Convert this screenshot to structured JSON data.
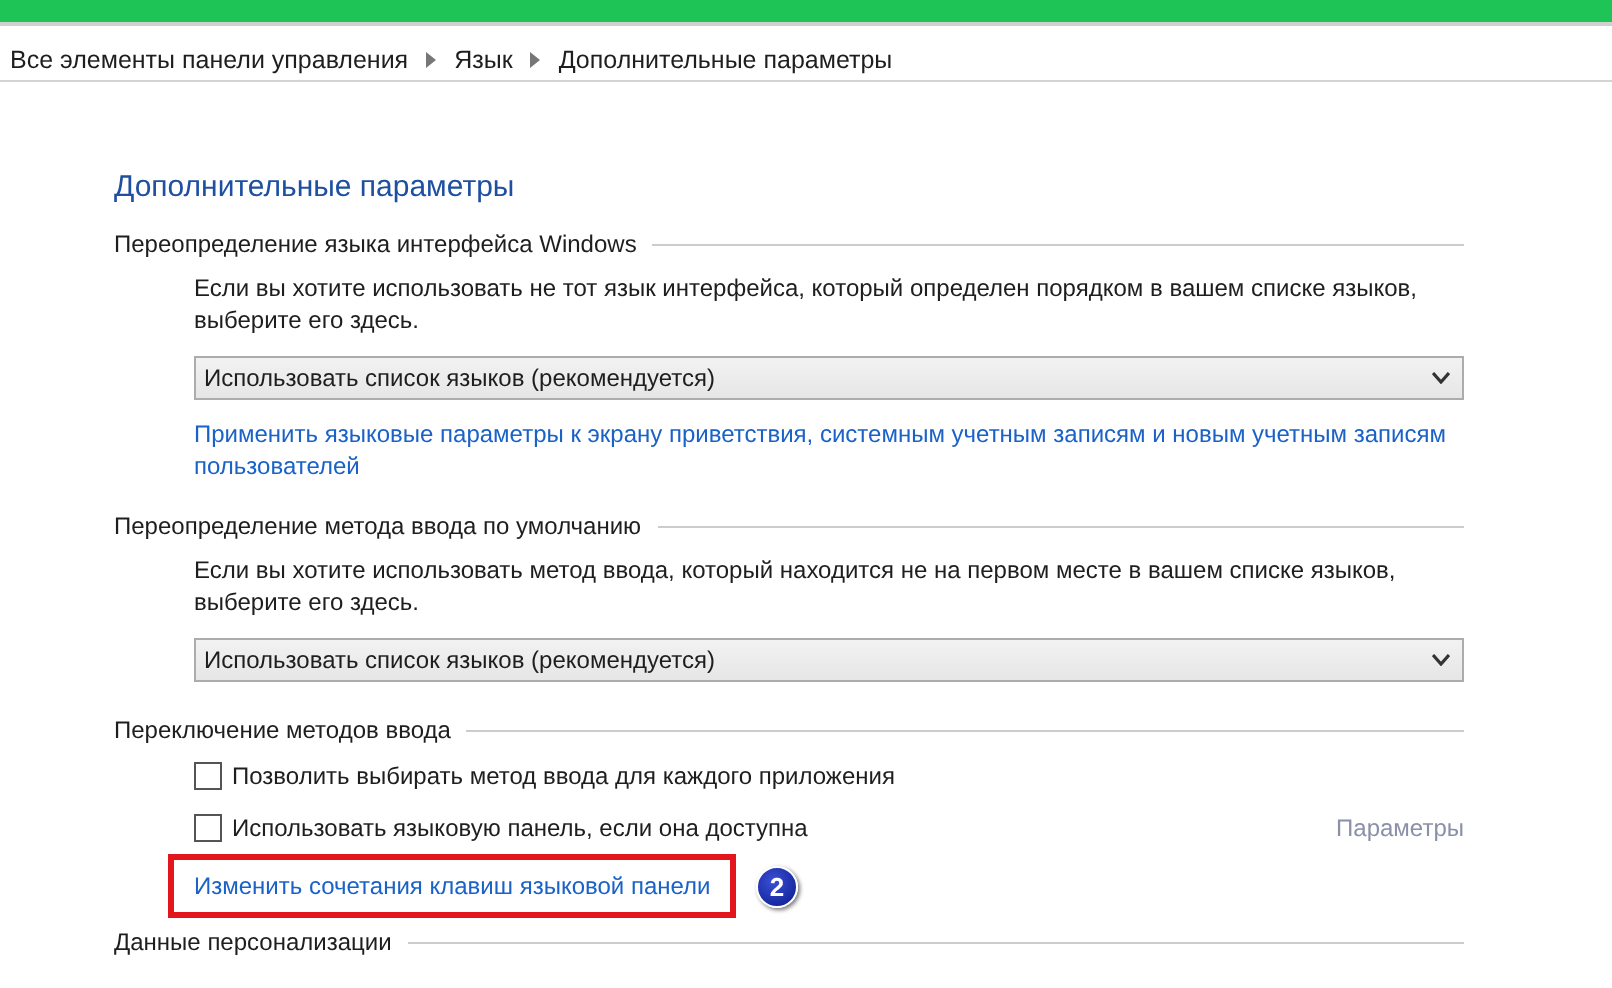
{
  "breadcrumb": [
    "Все элементы панели управления",
    "Язык",
    "Дополнительные параметры"
  ],
  "page_title": "Дополнительные параметры",
  "sections": [
    {
      "heading": "Переопределение языка интерфейса Windows",
      "items": [
        {
          "kind": "description",
          "text": "Если вы хотите использовать не тот язык интерфейса, который определен порядком в вашем списке языков, выберите его здесь."
        },
        {
          "kind": "dropdown",
          "value": "Использовать список языков (рекомендуется)"
        },
        {
          "kind": "link",
          "text": "Применить языковые параметры к экрану приветствия, системным учетным записям и новым учетным записям пользователей"
        }
      ]
    },
    {
      "heading": "Переопределение метода ввода по умолчанию",
      "items": [
        {
          "kind": "description",
          "text": "Если вы хотите использовать метод ввода, который находится не на первом месте в вашем списке языков, выберите его здесь."
        },
        {
          "kind": "dropdown",
          "value": "Использовать список языков (рекомендуется)"
        }
      ]
    },
    {
      "heading": "Переключение методов ввода",
      "items": [
        {
          "kind": "checkbox",
          "label": "Позволить выбирать метод ввода для каждого приложения",
          "checked": false
        },
        {
          "kind": "checkbox",
          "label": "Использовать языковую панель, если она доступна",
          "checked": false,
          "side_link": {
            "text": "Параметры",
            "disabled": true
          }
        },
        {
          "kind": "highlighted_link",
          "text": "Изменить сочетания клавиш языковой панели",
          "badge": "2"
        }
      ]
    },
    {
      "heading": "Данные персонализации"
    }
  ]
}
